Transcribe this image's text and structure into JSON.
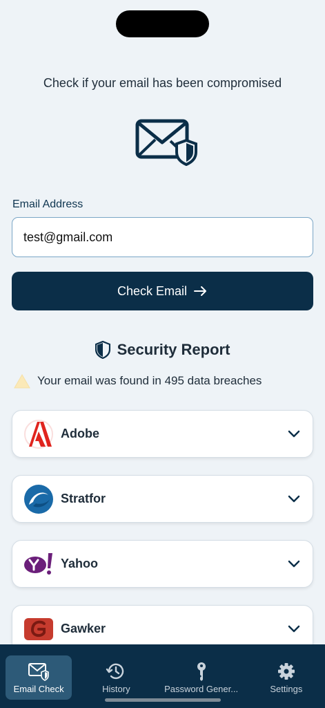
{
  "header": {
    "title": "Check if your email has been compromised"
  },
  "form": {
    "label": "Email Address",
    "value": "test@gmail.com",
    "button_label": "Check Email"
  },
  "report": {
    "title": "Security Report",
    "alert": "Your email was found in 495 data breaches",
    "breaches": [
      {
        "name": "Adobe"
      },
      {
        "name": "Stratfor"
      },
      {
        "name": "Yahoo"
      },
      {
        "name": "Gawker"
      }
    ]
  },
  "tabs": [
    {
      "label": "Email Check"
    },
    {
      "label": "History"
    },
    {
      "label": "Password Gener..."
    },
    {
      "label": "Settings"
    }
  ],
  "colors": {
    "primary": "#0b2e48",
    "background": "#eef3f7",
    "active_tab": "#2d5a78"
  }
}
